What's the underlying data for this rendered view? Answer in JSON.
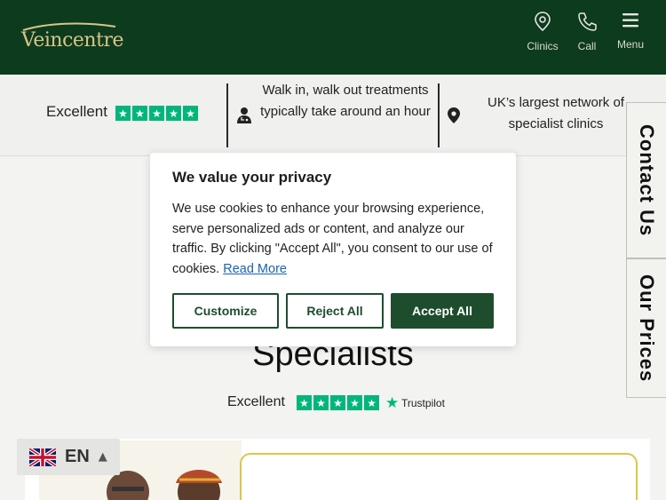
{
  "brand": {
    "name": "Veincentre"
  },
  "header": {
    "nav": [
      {
        "label": "Clinics",
        "icon": "map-pin-icon"
      },
      {
        "label": "Call",
        "icon": "phone-icon"
      },
      {
        "label": "Menu",
        "icon": "hamburger-icon"
      }
    ]
  },
  "strip": {
    "rating_label": "Excellent",
    "rating_stars": 5,
    "feature_1": "Walk in, walk out treatments typically take around an hour",
    "feature_2": "UK’s largest network of specialist clinics"
  },
  "side_tabs": {
    "contact": "Contact Us",
    "prices": "Our Prices"
  },
  "content": {
    "heading": "Specialists",
    "trustpilot": {
      "rating_label": "Excellent",
      "brand": "Trustpilot",
      "stars": 5
    }
  },
  "cookie": {
    "title": "We value your privacy",
    "body": "We use cookies to enhance your browsing experience, serve personalized ads or content, and analyze our traffic. By clicking \"Accept All\", you consent to our use of cookies.",
    "read_more": "Read More",
    "buttons": {
      "customize": "Customize",
      "reject": "Reject All",
      "accept": "Accept All"
    }
  },
  "language": {
    "code": "EN",
    "flag": "uk-flag-icon"
  },
  "colors": {
    "header_bg": "#0d3b1d",
    "accent_green": "#1e4d2e",
    "trustpilot_green": "#00b67a",
    "gold": "#d8c48a",
    "card_border": "#dcc64a"
  }
}
